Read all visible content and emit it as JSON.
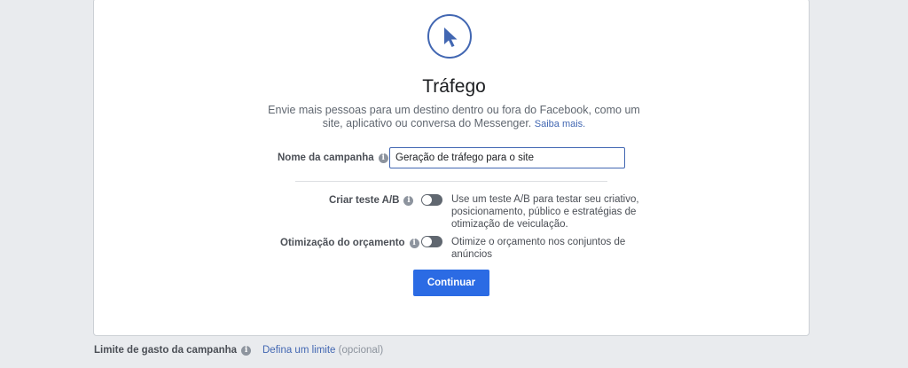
{
  "objective": {
    "icon": "cursor-icon",
    "title": "Tráfego",
    "description": "Envie mais pessoas para um destino dentro ou fora do Facebook, como um site, aplicativo ou conversa do Messenger.",
    "learn_more": "Saiba mais."
  },
  "campaign_name": {
    "label": "Nome da campanha",
    "value": "Geração de tráfego para o site"
  },
  "ab_test": {
    "label": "Criar teste A/B",
    "description": "Use um teste A/B para testar seu criativo, posicionamento, público e estratégias de otimização de veiculação.",
    "enabled": false
  },
  "budget_optimization": {
    "label": "Otimização do orçamento",
    "description": "Otimize o orçamento nos conjuntos de anúncios",
    "enabled": false
  },
  "continue_label": "Continuar",
  "spend_limit": {
    "label": "Limite de gasto da campanha",
    "link": "Defina um limite",
    "optional": "(opcional)"
  },
  "colors": {
    "accent": "#4267b2",
    "button": "#2b6be4",
    "toggle_off": "#606770"
  }
}
